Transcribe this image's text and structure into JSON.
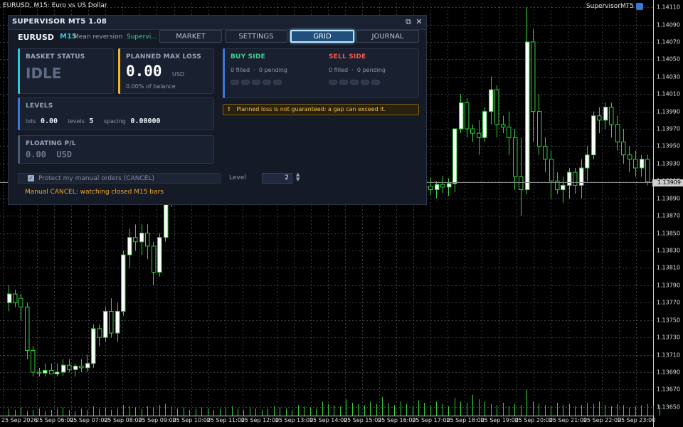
{
  "chart": {
    "title": "EURUSD, M15:  Euro vs US Dollar",
    "ea_label": "SupervisorMT5",
    "current_price": "1.13909",
    "price_levels": [
      "1.14110",
      "1.14090",
      "1.14070",
      "1.14050",
      "1.14030",
      "1.14010",
      "1.13990",
      "1.13970",
      "1.13950",
      "1.13930",
      "1.13910",
      "1.13890",
      "1.13870",
      "1.13850",
      "1.13830",
      "1.13810",
      "1.13790",
      "1.13770",
      "1.13750",
      "1.13730",
      "1.13710",
      "1.13690",
      "1.13670",
      "1.13650"
    ],
    "time_labels": [
      "25 Sep 2026",
      "25 Sep 06:00",
      "25 Sep 07:00",
      "25 Sep 08:00",
      "25 Sep 09:00",
      "25 Sep 10:00",
      "25 Sep 11:00",
      "25 Sep 12:00",
      "25 Sep 13:00",
      "25 Sep 14:00",
      "25 Sep 15:00",
      "25 Sep 16:00",
      "25 Sep 17:00",
      "25 Sep 18:00",
      "25 Sep 19:00",
      "25 Sep 20:00",
      "25 Sep 21:00",
      "25 Sep 22:00",
      "25 Sep 23:00"
    ]
  },
  "chart_data": {
    "type": "candlestick",
    "title": "EURUSD, M15",
    "y_range": [
      1.1364,
      1.14115
    ],
    "candles": [
      {
        "o": 1.1377,
        "h": 1.1379,
        "l": 1.1376,
        "c": 1.1378
      },
      {
        "o": 1.1378,
        "h": 1.13785,
        "l": 1.13765,
        "c": 1.1377
      },
      {
        "o": 1.13775,
        "h": 1.1378,
        "l": 1.1375,
        "c": 1.13765
      },
      {
        "o": 1.13765,
        "h": 1.1377,
        "l": 1.13705,
        "c": 1.13715
      },
      {
        "o": 1.13715,
        "h": 1.1372,
        "l": 1.13685,
        "c": 1.1369
      },
      {
        "o": 1.1369,
        "h": 1.13695,
        "l": 1.13685,
        "c": 1.13689
      },
      {
        "o": 1.13689,
        "h": 1.137,
        "l": 1.13685,
        "c": 1.13692
      },
      {
        "o": 1.13692,
        "h": 1.137,
        "l": 1.13688,
        "c": 1.13688
      },
      {
        "o": 1.13688,
        "h": 1.137,
        "l": 1.13685,
        "c": 1.1369
      },
      {
        "o": 1.1369,
        "h": 1.13705,
        "l": 1.13686,
        "c": 1.13698
      },
      {
        "o": 1.13698,
        "h": 1.13705,
        "l": 1.1369,
        "c": 1.13693
      },
      {
        "o": 1.13693,
        "h": 1.137,
        "l": 1.13685,
        "c": 1.13697
      },
      {
        "o": 1.13697,
        "h": 1.13705,
        "l": 1.1369,
        "c": 1.13695
      },
      {
        "o": 1.13695,
        "h": 1.1371,
        "l": 1.1369,
        "c": 1.137
      },
      {
        "o": 1.137,
        "h": 1.13745,
        "l": 1.13695,
        "c": 1.1374
      },
      {
        "o": 1.1374,
        "h": 1.13745,
        "l": 1.1372,
        "c": 1.1373
      },
      {
        "o": 1.1373,
        "h": 1.13765,
        "l": 1.13725,
        "c": 1.1376
      },
      {
        "o": 1.1376,
        "h": 1.13775,
        "l": 1.1373,
        "c": 1.13735
      },
      {
        "o": 1.13735,
        "h": 1.1377,
        "l": 1.13725,
        "c": 1.1376
      },
      {
        "o": 1.1376,
        "h": 1.1383,
        "l": 1.13755,
        "c": 1.13825
      },
      {
        "o": 1.13825,
        "h": 1.13855,
        "l": 1.1381,
        "c": 1.13845
      },
      {
        "o": 1.13845,
        "h": 1.1386,
        "l": 1.1383,
        "c": 1.1384
      },
      {
        "o": 1.1384,
        "h": 1.1386,
        "l": 1.13825,
        "c": 1.1385
      },
      {
        "o": 1.1385,
        "h": 1.1386,
        "l": 1.1382,
        "c": 1.13835
      },
      {
        "o": 1.13835,
        "h": 1.1384,
        "l": 1.1379,
        "c": 1.13805
      },
      {
        "o": 1.13805,
        "h": 1.1385,
        "l": 1.138,
        "c": 1.13845
      },
      {
        "o": 1.13845,
        "h": 1.139,
        "l": 1.1384,
        "c": 1.13895
      },
      {
        "o": 1.13895,
        "h": 1.13915,
        "l": 1.1388,
        "c": 1.13905
      },
      {
        "o": 1.13905,
        "h": 1.1391,
        "l": 1.13885,
        "c": 1.13895
      },
      {
        "o": 1.13895,
        "h": 1.13905,
        "l": 1.13885,
        "c": 1.139
      },
      {
        "o": 1.139,
        "h": 1.1391,
        "l": 1.1389,
        "c": 1.13902
      },
      {
        "o": 1.13902,
        "h": 1.13912,
        "l": 1.13892,
        "c": 1.13898
      },
      {
        "o": 1.13898,
        "h": 1.13908,
        "l": 1.13888,
        "c": 1.13904
      },
      {
        "o": 1.13904,
        "h": 1.13915,
        "l": 1.13895,
        "c": 1.139
      },
      {
        "o": 1.139,
        "h": 1.1391,
        "l": 1.1389,
        "c": 1.13902
      },
      {
        "o": 1.13902,
        "h": 1.13915,
        "l": 1.13895,
        "c": 1.13908
      },
      {
        "o": 1.13908,
        "h": 1.13918,
        "l": 1.13898,
        "c": 1.13903
      },
      {
        "o": 1.13903,
        "h": 1.13913,
        "l": 1.13893,
        "c": 1.13906
      },
      {
        "o": 1.13906,
        "h": 1.13916,
        "l": 1.13896,
        "c": 1.13902
      },
      {
        "o": 1.13902,
        "h": 1.13912,
        "l": 1.13892,
        "c": 1.13905
      },
      {
        "o": 1.13905,
        "h": 1.13915,
        "l": 1.13895,
        "c": 1.139
      },
      {
        "o": 1.139,
        "h": 1.13912,
        "l": 1.1389,
        "c": 1.13906
      },
      {
        "o": 1.13906,
        "h": 1.13916,
        "l": 1.13896,
        "c": 1.13903
      },
      {
        "o": 1.13903,
        "h": 1.13913,
        "l": 1.13893,
        "c": 1.13907
      },
      {
        "o": 1.13907,
        "h": 1.13917,
        "l": 1.13897,
        "c": 1.13902
      },
      {
        "o": 1.13902,
        "h": 1.13912,
        "l": 1.13892,
        "c": 1.13905
      },
      {
        "o": 1.13905,
        "h": 1.13915,
        "l": 1.13895,
        "c": 1.139
      },
      {
        "o": 1.139,
        "h": 1.13912,
        "l": 1.1389,
        "c": 1.13906
      },
      {
        "o": 1.13906,
        "h": 1.13916,
        "l": 1.13896,
        "c": 1.13902
      },
      {
        "o": 1.13902,
        "h": 1.13912,
        "l": 1.13892,
        "c": 1.13904
      },
      {
        "o": 1.13904,
        "h": 1.13914,
        "l": 1.13894,
        "c": 1.139
      },
      {
        "o": 1.139,
        "h": 1.1391,
        "l": 1.1389,
        "c": 1.13906
      },
      {
        "o": 1.13906,
        "h": 1.13916,
        "l": 1.13896,
        "c": 1.13903
      },
      {
        "o": 1.13903,
        "h": 1.13913,
        "l": 1.13893,
        "c": 1.13907
      },
      {
        "o": 1.13907,
        "h": 1.13917,
        "l": 1.13897,
        "c": 1.13902
      },
      {
        "o": 1.13902,
        "h": 1.13912,
        "l": 1.13892,
        "c": 1.13905
      },
      {
        "o": 1.13905,
        "h": 1.13915,
        "l": 1.13895,
        "c": 1.139
      },
      {
        "o": 1.139,
        "h": 1.13912,
        "l": 1.1389,
        "c": 1.13906
      },
      {
        "o": 1.13906,
        "h": 1.13916,
        "l": 1.13896,
        "c": 1.13902
      },
      {
        "o": 1.13902,
        "h": 1.13912,
        "l": 1.13892,
        "c": 1.13904
      },
      {
        "o": 1.13904,
        "h": 1.13914,
        "l": 1.13894,
        "c": 1.139
      },
      {
        "o": 1.139,
        "h": 1.1391,
        "l": 1.1389,
        "c": 1.13906
      },
      {
        "o": 1.13906,
        "h": 1.13916,
        "l": 1.13896,
        "c": 1.13903
      },
      {
        "o": 1.13903,
        "h": 1.13913,
        "l": 1.13893,
        "c": 1.13907
      },
      {
        "o": 1.13907,
        "h": 1.13917,
        "l": 1.13897,
        "c": 1.13902
      },
      {
        "o": 1.13902,
        "h": 1.13912,
        "l": 1.13892,
        "c": 1.13905
      },
      {
        "o": 1.13905,
        "h": 1.13915,
        "l": 1.13895,
        "c": 1.139
      },
      {
        "o": 1.139,
        "h": 1.13912,
        "l": 1.1389,
        "c": 1.13906
      },
      {
        "o": 1.13906,
        "h": 1.13916,
        "l": 1.13896,
        "c": 1.13902
      },
      {
        "o": 1.13902,
        "h": 1.13912,
        "l": 1.13892,
        "c": 1.13904
      },
      {
        "o": 1.13904,
        "h": 1.13914,
        "l": 1.13894,
        "c": 1.139
      },
      {
        "o": 1.139,
        "h": 1.1391,
        "l": 1.1389,
        "c": 1.13906
      },
      {
        "o": 1.13906,
        "h": 1.13916,
        "l": 1.13896,
        "c": 1.13903
      },
      {
        "o": 1.13903,
        "h": 1.13913,
        "l": 1.13893,
        "c": 1.13907
      },
      {
        "o": 1.13907,
        "h": 1.13917,
        "l": 1.13897,
        "c": 1.1397
      },
      {
        "o": 1.1397,
        "h": 1.1401,
        "l": 1.13965,
        "c": 1.14
      },
      {
        "o": 1.14,
        "h": 1.14005,
        "l": 1.1396,
        "c": 1.1397
      },
      {
        "o": 1.1397,
        "h": 1.13975,
        "l": 1.13955,
        "c": 1.13965
      },
      {
        "o": 1.13965,
        "h": 1.1398,
        "l": 1.1394,
        "c": 1.1396
      },
      {
        "o": 1.1396,
        "h": 1.13995,
        "l": 1.13955,
        "c": 1.1399
      },
      {
        "o": 1.1399,
        "h": 1.1403,
        "l": 1.13975,
        "c": 1.14015
      },
      {
        "o": 1.14015,
        "h": 1.1402,
        "l": 1.1396,
        "c": 1.13975
      },
      {
        "o": 1.13975,
        "h": 1.13985,
        "l": 1.13965,
        "c": 1.13972
      },
      {
        "o": 1.13972,
        "h": 1.1399,
        "l": 1.1394,
        "c": 1.1396
      },
      {
        "o": 1.1396,
        "h": 1.1397,
        "l": 1.139,
        "c": 1.13915
      },
      {
        "o": 1.13915,
        "h": 1.1396,
        "l": 1.1387,
        "c": 1.139
      },
      {
        "o": 1.139,
        "h": 1.1411,
        "l": 1.13895,
        "c": 1.1407
      },
      {
        "o": 1.1407,
        "h": 1.14085,
        "l": 1.13955,
        "c": 1.1399
      },
      {
        "o": 1.1399,
        "h": 1.1401,
        "l": 1.1394,
        "c": 1.1395
      },
      {
        "o": 1.1395,
        "h": 1.1396,
        "l": 1.1392,
        "c": 1.13935
      },
      {
        "o": 1.13935,
        "h": 1.13945,
        "l": 1.1389,
        "c": 1.1391
      },
      {
        "o": 1.1391,
        "h": 1.1392,
        "l": 1.13895,
        "c": 1.139
      },
      {
        "o": 1.139,
        "h": 1.13915,
        "l": 1.13885,
        "c": 1.13905
      },
      {
        "o": 1.13905,
        "h": 1.13925,
        "l": 1.1389,
        "c": 1.1392
      },
      {
        "o": 1.1392,
        "h": 1.13925,
        "l": 1.13895,
        "c": 1.13905
      },
      {
        "o": 1.13905,
        "h": 1.13935,
        "l": 1.1389,
        "c": 1.13925
      },
      {
        "o": 1.13925,
        "h": 1.1395,
        "l": 1.1391,
        "c": 1.1394
      },
      {
        "o": 1.1394,
        "h": 1.1399,
        "l": 1.13935,
        "c": 1.13985
      },
      {
        "o": 1.13985,
        "h": 1.13995,
        "l": 1.13965,
        "c": 1.1398
      },
      {
        "o": 1.1398,
        "h": 1.14,
        "l": 1.1397,
        "c": 1.13995
      },
      {
        "o": 1.13995,
        "h": 1.14,
        "l": 1.1396,
        "c": 1.13975
      },
      {
        "o": 1.13975,
        "h": 1.13985,
        "l": 1.13945,
        "c": 1.13955
      },
      {
        "o": 1.13955,
        "h": 1.1397,
        "l": 1.1393,
        "c": 1.1394
      },
      {
        "o": 1.1394,
        "h": 1.1395,
        "l": 1.1392,
        "c": 1.13935
      },
      {
        "o": 1.13935,
        "h": 1.13945,
        "l": 1.13915,
        "c": 1.13925
      },
      {
        "o": 1.13925,
        "h": 1.1394,
        "l": 1.13915,
        "c": 1.13935
      },
      {
        "o": 1.13935,
        "h": 1.1394,
        "l": 1.13905,
        "c": 1.13909
      }
    ],
    "volumes": [
      6,
      5,
      7,
      4,
      5,
      6,
      4,
      5,
      6,
      7,
      5,
      4,
      6,
      5,
      8,
      6,
      7,
      5,
      6,
      9,
      8,
      7,
      6,
      8,
      7,
      9,
      10,
      8,
      6,
      7,
      5,
      6,
      7,
      6,
      5,
      6,
      7,
      8,
      6,
      5,
      7,
      6,
      5,
      6,
      8,
      7,
      6,
      5,
      9,
      8,
      7,
      6,
      12,
      10,
      9,
      8,
      14,
      11,
      10,
      9,
      12,
      10,
      16,
      11,
      9,
      12,
      10,
      8,
      13,
      11,
      9,
      12,
      10,
      8,
      15,
      12,
      11,
      18,
      14,
      12,
      10,
      9,
      11,
      8,
      10,
      9,
      22,
      12,
      10,
      9,
      8,
      11,
      9,
      10,
      8,
      9,
      11,
      10,
      12,
      9,
      8,
      10,
      9,
      7,
      8,
      9,
      10,
      8,
      9
    ]
  },
  "panel": {
    "title": "SUPERVISOR MT5   1.08",
    "symbol": "EURUSD",
    "timeframe": "M15",
    "mode": "Mean reversion",
    "state": "Supervi...",
    "tabs": [
      "MARKET",
      "SETTINGS",
      "GRID",
      "JOURNAL"
    ],
    "active_tab": "GRID",
    "basket": {
      "header": "BASKET STATUS",
      "value": "IDLE"
    },
    "planned": {
      "header": "PLANNED MAX LOSS",
      "value": "0.00",
      "unit": "USD",
      "sub": "0.00% of balance"
    },
    "levels": {
      "header": "LEVELS",
      "lots_label": "lots",
      "lots": "0.00",
      "levels_label": "levels",
      "levels": "5",
      "spacing_label": "spacing",
      "spacing": "0.00000"
    },
    "floating": {
      "header": "FLOATING P/L",
      "value": "0.00  USD"
    },
    "buy": {
      "header": "BUY SIDE",
      "status": "0 filled  ·  0 pending"
    },
    "sell": {
      "header": "SELL SIDE",
      "status": "0 filled  ·  0 pending"
    },
    "warning": "Planned loss is not guaranteed: a gap can exceed it.",
    "protect_label": "Protect my manual orders (CANCEL)",
    "protect_checked": true,
    "level_label": "Level",
    "level_value": "2",
    "manual_status": "Manual CANCEL: watching closed M15 bars"
  },
  "colors": {
    "bull": "#ffffff",
    "bear": "#000000",
    "wick": "#2fd33a",
    "grid": "#3a3f47",
    "volume": "#2fd33a",
    "accent_cyan": "#2ec7d8",
    "buy": "#3bd28c",
    "sell": "#f05a4a",
    "warn": "#f0c24a"
  }
}
